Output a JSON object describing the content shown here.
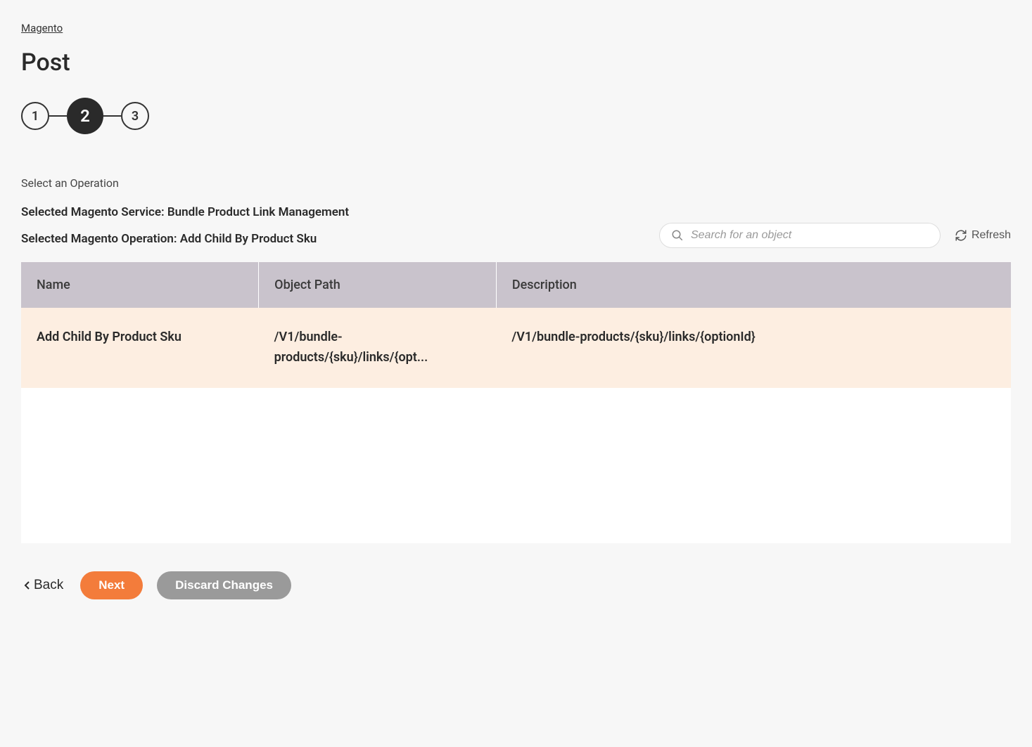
{
  "breadcrumb": {
    "root": "Magento"
  },
  "page_title": "Post",
  "stepper": {
    "steps": [
      "1",
      "2",
      "3"
    ],
    "active_index": 1
  },
  "section_label": "Select an Operation",
  "selected_service_label": "Selected Magento Service: Bundle Product Link Management",
  "selected_operation_label": "Selected Magento Operation: Add Child By Product Sku",
  "search": {
    "placeholder": "Search for an object",
    "value": ""
  },
  "refresh_label": "Refresh",
  "table": {
    "headers": {
      "name": "Name",
      "object_path": "Object Path",
      "description": "Description"
    },
    "rows": [
      {
        "name": "Add Child By Product Sku",
        "object_path": "/V1/bundle-products/{sku}/links/{opt...",
        "description": "/V1/bundle-products/{sku}/links/{optionId}",
        "selected": true
      }
    ]
  },
  "footer": {
    "back": "Back",
    "next": "Next",
    "discard": "Discard Changes"
  }
}
